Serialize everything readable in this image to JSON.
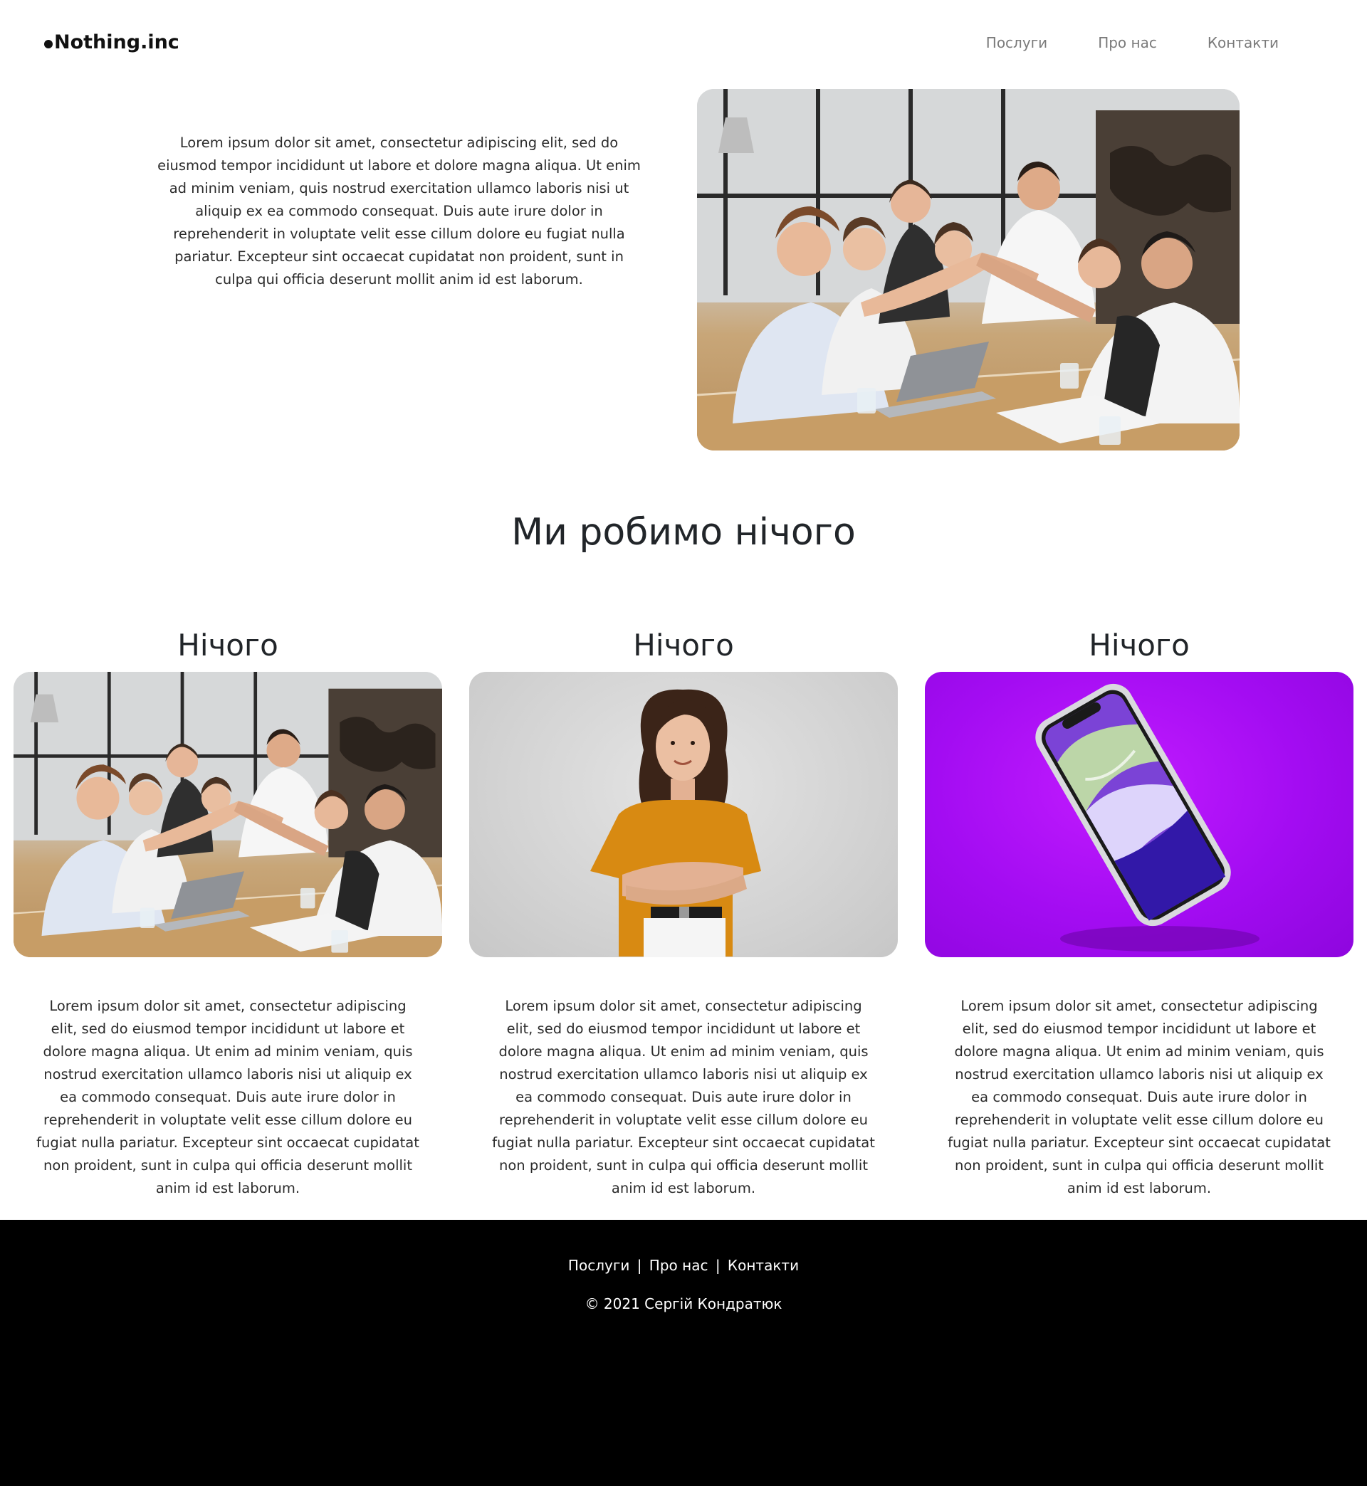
{
  "header": {
    "logo": "Nothing.inc",
    "nav": [
      "Послуги",
      "Про нас",
      "Контакти"
    ]
  },
  "hero": {
    "text": "Lorem ipsum dolor sit amet, consectetur adipiscing elit, sed do eiusmod tempor incididunt ut labore et dolore magna aliqua. Ut enim ad minim veniam, quis nostrud exercitation ullamco laboris nisi ut aliquip ex ea commodo consequat. Duis aute irure dolor in reprehenderit in voluptate velit esse cillum dolore eu fugiat nulla pariatur. Excepteur sint occaecat cupidatat non proident, sunt in culpa qui officia deserunt mollit anim id est laborum."
  },
  "section": {
    "title": "Ми робимо нічого"
  },
  "cards": [
    {
      "title": "Нічого",
      "text": "Lorem ipsum dolor sit amet, consectetur adipiscing elit, sed do eiusmod tempor incididunt ut labore et dolore magna aliqua. Ut enim ad minim veniam, quis nostrud exercitation ullamco laboris nisi ut aliquip ex ea commodo consequat. Duis aute irure dolor in reprehenderit in voluptate velit esse cillum dolore eu fugiat nulla pariatur. Excepteur sint occaecat cupidatat non proident, sunt in culpa qui officia deserunt mollit anim id est laborum."
    },
    {
      "title": "Нічого",
      "text": "Lorem ipsum dolor sit amet, consectetur adipiscing elit, sed do eiusmod tempor incididunt ut labore et dolore magna aliqua. Ut enim ad minim veniam, quis nostrud exercitation ullamco laboris nisi ut aliquip ex ea commodo consequat. Duis aute irure dolor in reprehenderit in voluptate velit esse cillum dolore eu fugiat nulla pariatur. Excepteur sint occaecat cupidatat non proident, sunt in culpa qui officia deserunt mollit anim id est laborum."
    },
    {
      "title": "Нічого",
      "text": "Lorem ipsum dolor sit amet, consectetur adipiscing elit, sed do eiusmod tempor incididunt ut labore et dolore magna aliqua. Ut enim ad minim veniam, quis nostrud exercitation ullamco laboris nisi ut aliquip ex ea commodo consequat. Duis aute irure dolor in reprehenderit in voluptate velit esse cillum dolore eu fugiat nulla pariatur. Excepteur sint occaecat cupidatat non proident, sunt in culpa qui officia deserunt mollit anim id est laborum."
    }
  ],
  "footer": {
    "links": [
      "Послуги",
      "Про нас",
      "Контакти"
    ],
    "separator": "|",
    "copyright": "© 2021 Сергій Кондратюк"
  },
  "colors": {
    "background": "#ffffff",
    "text": "#212529",
    "nav_text": "#7a7a7a",
    "footer_bg": "#000000",
    "footer_text": "#ffffff",
    "phone_bg": "#a30cf2",
    "shirt_orange": "#d88a12"
  }
}
